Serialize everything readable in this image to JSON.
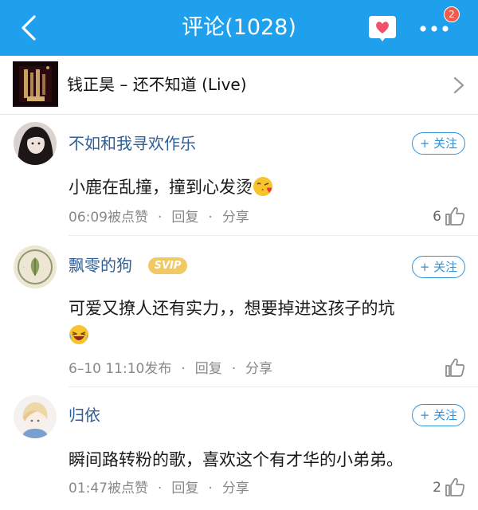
{
  "header": {
    "title": "评论(1028)",
    "notification_count": "2"
  },
  "song": {
    "title": "钱正昊 – 还不知道 (Live)"
  },
  "comments": [
    {
      "username": "不如和我寻欢作乐",
      "vip_badge": "",
      "follow_label": "+ 关注",
      "text": "小鹿在乱撞，撞到心发烫",
      "emoji": "kiss-emoji",
      "time": "06:09被点赞",
      "reply_label": "回复",
      "share_label": "分享",
      "like_count": "6"
    },
    {
      "username": "飘零的狗",
      "vip_badge": "SVIP",
      "follow_label": "+ 关注",
      "text": "可爱又撩人还有实力，，想要掉进这孩子的坑",
      "emoji": "laughing-emoji",
      "time": "6–10 11:10发布",
      "reply_label": "回复",
      "share_label": "分享",
      "like_count": ""
    },
    {
      "username": "归依",
      "vip_badge": "",
      "follow_label": "+ 关注",
      "text": "瞬间路转粉的歌，喜欢这个有才华的小弟弟。",
      "emoji": "",
      "time": "01:47被点赞",
      "reply_label": "回复",
      "share_label": "分享",
      "like_count": "2"
    }
  ],
  "colors": {
    "header_bg": "#1fa0ec",
    "username": "#2f5f96",
    "follow": "#2f93d8",
    "badge": "#f25a4a",
    "svip": "#f2c862"
  }
}
